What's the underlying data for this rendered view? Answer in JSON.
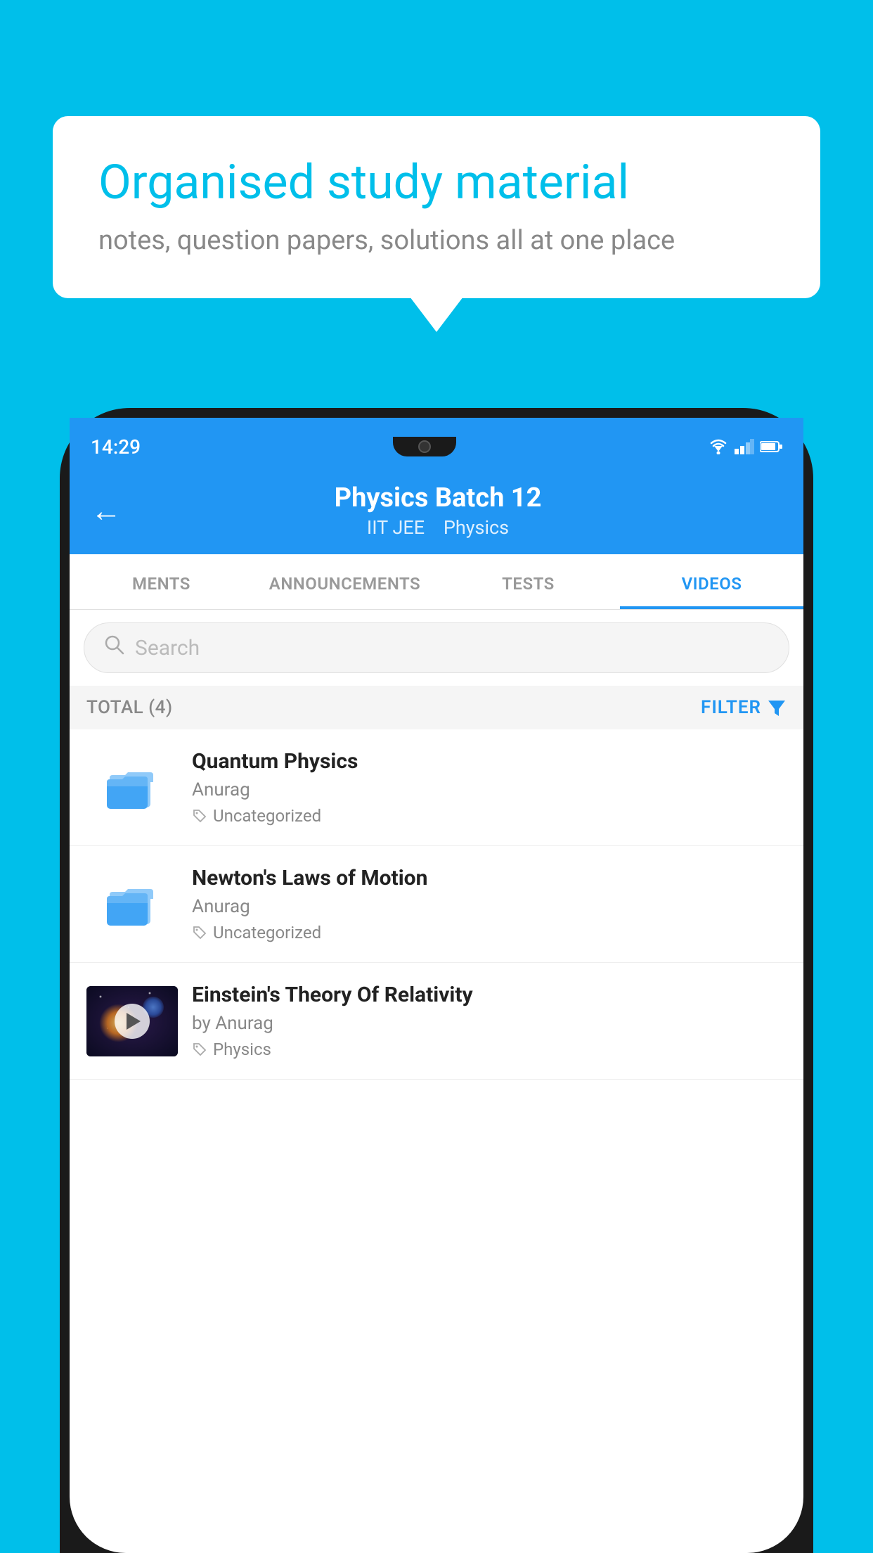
{
  "background_color": "#00BFEA",
  "speech_bubble": {
    "headline": "Organised study material",
    "subtext": "notes, question papers, solutions all at one place"
  },
  "phone": {
    "status_bar": {
      "time": "14:29"
    },
    "app_header": {
      "back_label": "←",
      "title": "Physics Batch 12",
      "subtitle_parts": [
        "IIT JEE",
        "Physics"
      ]
    },
    "tabs": [
      {
        "label": "MENTS",
        "active": false
      },
      {
        "label": "ANNOUNCEMENTS",
        "active": false
      },
      {
        "label": "TESTS",
        "active": false
      },
      {
        "label": "VIDEOS",
        "active": true
      }
    ],
    "search": {
      "placeholder": "Search"
    },
    "filter_row": {
      "total_label": "TOTAL (4)",
      "filter_label": "FILTER"
    },
    "videos": [
      {
        "id": "quantum",
        "title": "Quantum Physics",
        "author": "Anurag",
        "tag": "Uncategorized",
        "type": "folder"
      },
      {
        "id": "newton",
        "title": "Newton's Laws of Motion",
        "author": "Anurag",
        "tag": "Uncategorized",
        "type": "folder"
      },
      {
        "id": "einstein",
        "title": "Einstein's Theory Of Relativity",
        "author": "by Anurag",
        "tag": "Physics",
        "type": "video"
      }
    ]
  }
}
